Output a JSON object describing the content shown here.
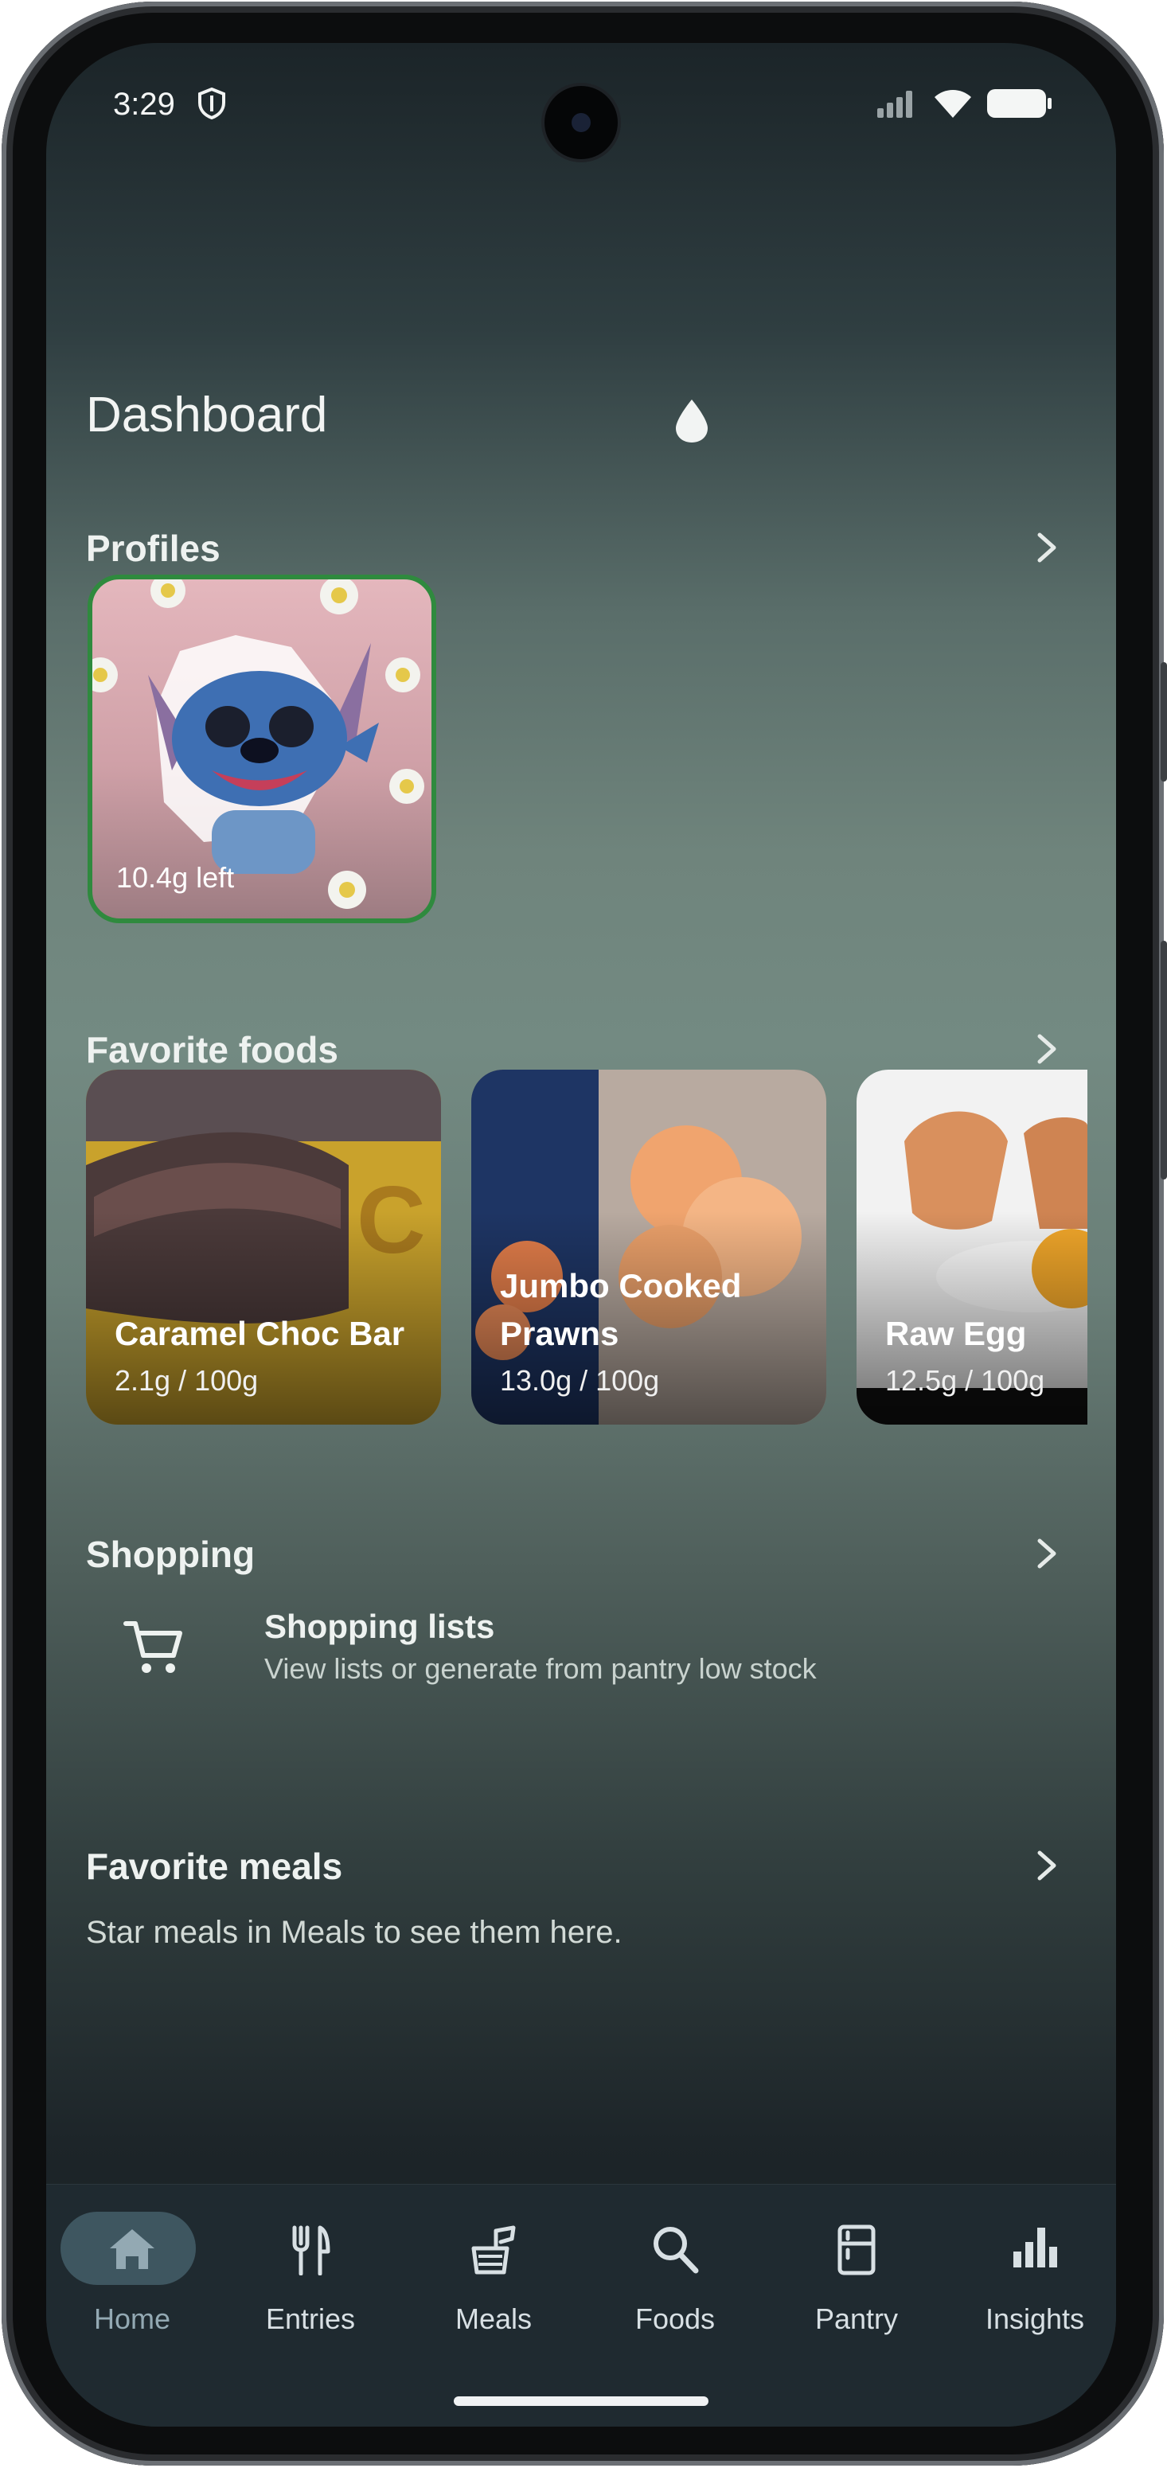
{
  "status_bar": {
    "time": "3:29"
  },
  "header": {
    "title": "Dashboard"
  },
  "sections": {
    "profiles": {
      "label": "Profiles"
    },
    "favorite_foods": {
      "label": "Favorite foods"
    },
    "shopping": {
      "label": "Shopping"
    },
    "favorite_meals": {
      "label": "Favorite meals"
    }
  },
  "profile": {
    "remaining": "10.4g left"
  },
  "favorite_foods": [
    {
      "name": "Caramel Choc Bar",
      "amount": "2.1g / 100g"
    },
    {
      "name": "Jumbo Cooked Prawns",
      "amount": "13.0g / 100g"
    },
    {
      "name": "Raw Egg",
      "amount": "12.5g / 100g"
    }
  ],
  "shopping": {
    "title": "Shopping lists",
    "subtitle": "View lists or generate from pantry low stock"
  },
  "favorite_meals": {
    "empty_text": "Star meals in Meals to see them here."
  },
  "nav": {
    "items": [
      {
        "label": "Home",
        "icon": "home-icon",
        "active": true
      },
      {
        "label": "Entries",
        "icon": "fork-knife-icon"
      },
      {
        "label": "Meals",
        "icon": "meal-bag-icon"
      },
      {
        "label": "Foods",
        "icon": "search-icon"
      },
      {
        "label": "Pantry",
        "icon": "fridge-icon"
      },
      {
        "label": "Insights",
        "icon": "bar-chart-icon"
      }
    ]
  },
  "colors": {
    "accent": "#2f8a3e",
    "nav_active_pill": "#3e5660",
    "nav_bg": "#1f2a30"
  }
}
